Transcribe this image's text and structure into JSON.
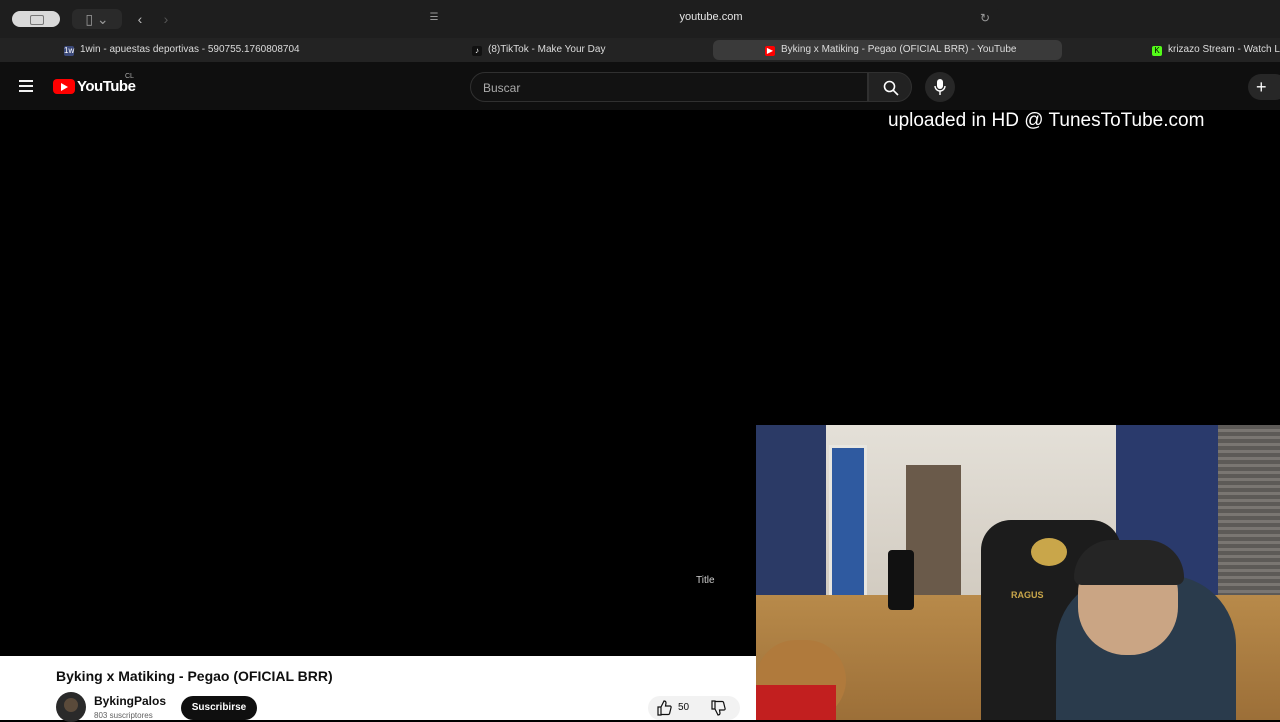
{
  "browser": {
    "url": "youtube.com",
    "tabs": [
      {
        "label": "1win - apuestas deportivas - 590755.1760808704",
        "favicon_text": "1w"
      },
      {
        "label": "(8)TikTok - Make Your Day",
        "favicon_text": "♪"
      },
      {
        "label": "Byking x Matiking - Pegao (OFICIAL BRR) - YouTube",
        "favicon_text": "▶"
      },
      {
        "label": "krizazo Stream - Watch L",
        "favicon_text": "K"
      }
    ]
  },
  "header": {
    "logo_text": "YouTube",
    "country_code": "CL",
    "search_placeholder": "Buscar"
  },
  "player": {
    "overlay_text": "uploaded in HD @ TunesToTube.com",
    "title_hint": "Title"
  },
  "video": {
    "title": "Byking x Matiking - Pegao (OFICIAL BRR)",
    "channel_name": "BykingPalos",
    "subscribers": "803 suscriptores",
    "subscribe_label": "Suscribirse",
    "like_count": "50"
  },
  "webcam": {
    "chair_text": "RAGUS"
  },
  "colors": {
    "brand": "#ff0000",
    "background": "#0f0f0f"
  }
}
